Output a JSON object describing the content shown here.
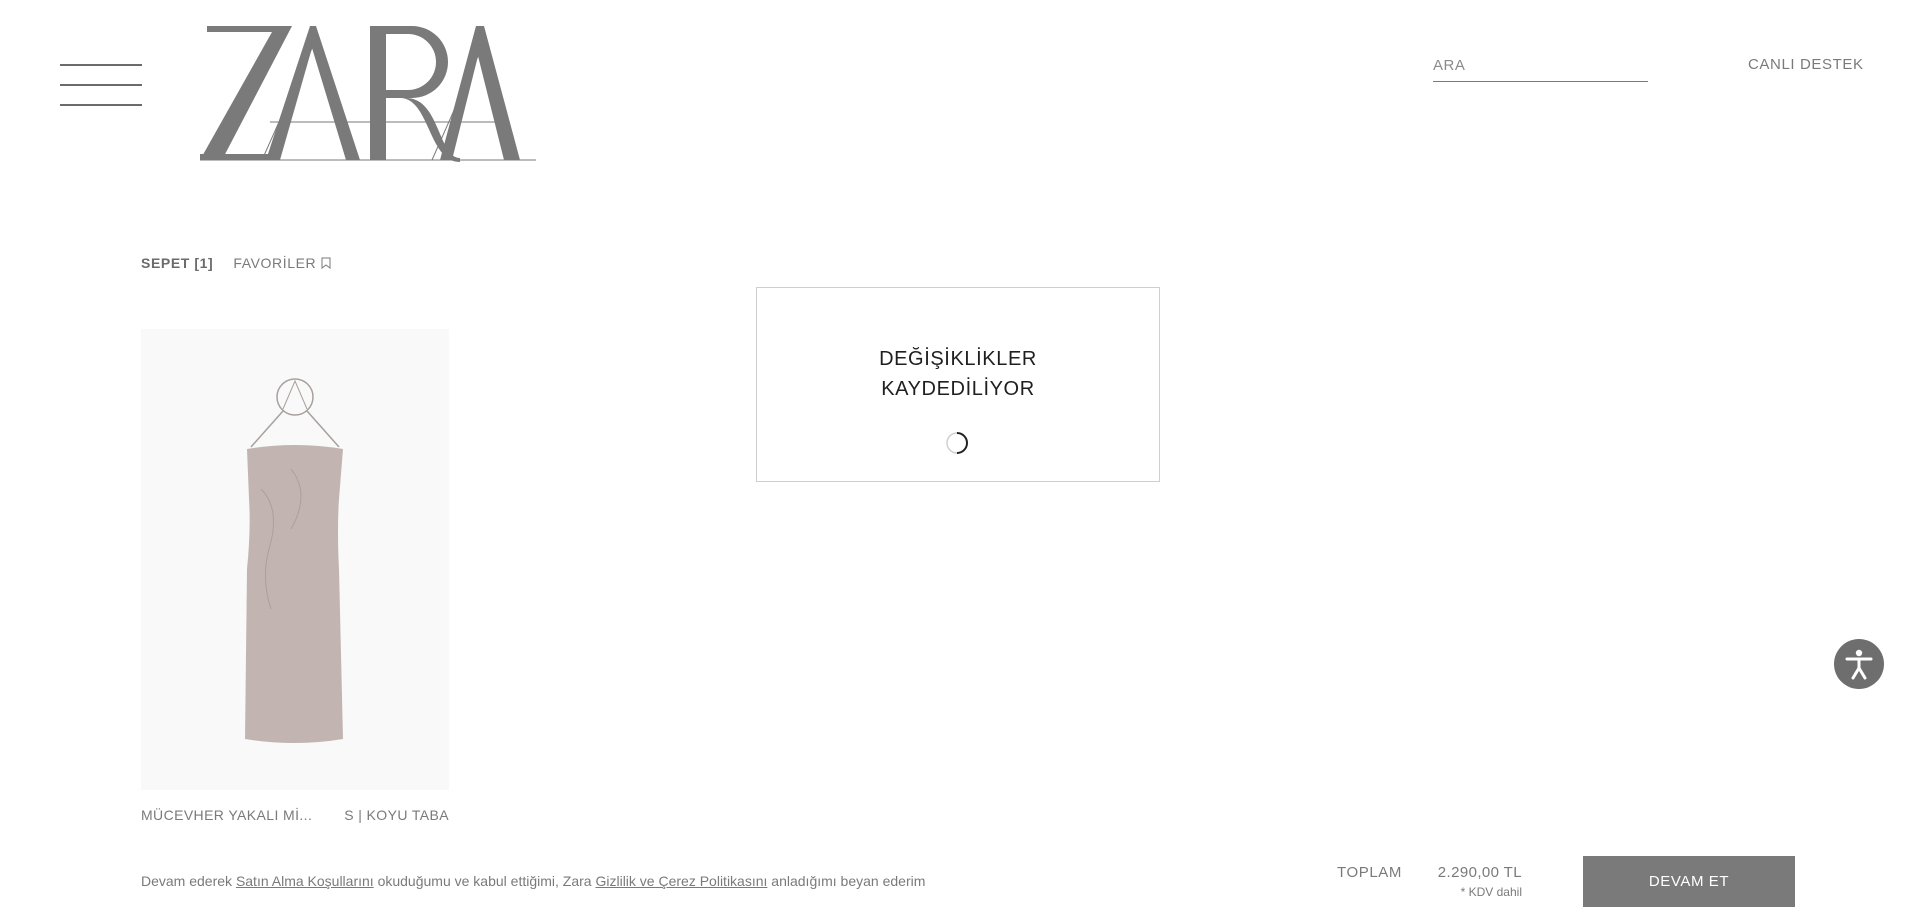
{
  "header": {
    "brand": "ZARA",
    "search_placeholder": "ARA",
    "live_support": "CANLI DESTEK"
  },
  "tabs": {
    "cart": "SEPET [1]",
    "favorites": "FAVORİLER"
  },
  "cart_item": {
    "name": "MÜCEVHER YAKALI Mİ...",
    "variant": "S | KOYU TABA",
    "dress_color": "#c2b5b1"
  },
  "modal": {
    "line1": "DEĞİŞİKLİKLER",
    "line2": "KAYDEDİLİYOR"
  },
  "legal": {
    "prefix": "Devam ederek ",
    "terms_link": "Satın Alma Koşullarını",
    "middle": " okuduğumu ve kabul ettiğimi, Zara ",
    "privacy_link": "Gizlilik ve Çerez Politikasını",
    "suffix": " anladığımı beyan ederim"
  },
  "summary": {
    "total_label": "TOPLAM",
    "total_value": "2.290,00 TL",
    "vat_note": "* KDV dahil",
    "continue_label": "DEVAM ET"
  },
  "colors": {
    "text": "#6b6b6b",
    "button_bg": "#7a7a7a",
    "modal_border": "#cfcfcf"
  },
  "icons": [
    "hamburger-menu-icon",
    "bookmark-icon",
    "loading-spinner-icon",
    "accessibility-icon"
  ]
}
